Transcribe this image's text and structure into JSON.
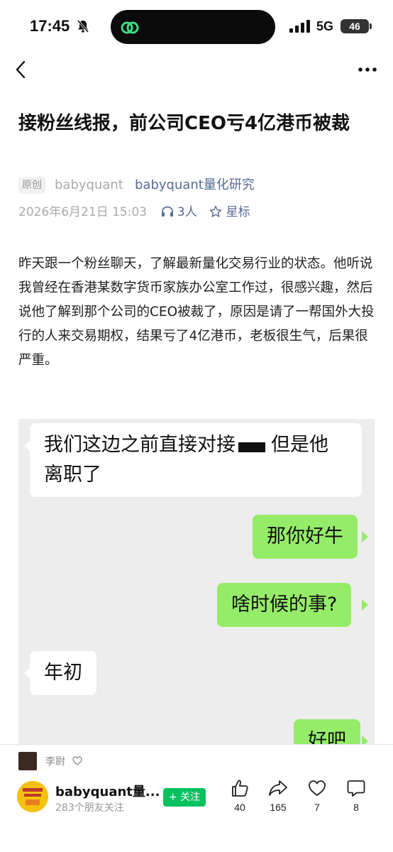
{
  "status_bar": {
    "time": "17:45",
    "network": "5G",
    "battery": "46"
  },
  "article": {
    "title": "接粉丝线报，前公司CEO亏4亿港币被裁",
    "original_tag": "原创",
    "author": "babyquant",
    "account": "babyquant量化研究",
    "date": "2026年6月21日 15:03",
    "listens": "3人",
    "star_label": "星标",
    "body": "昨天跟一个粉丝聊天，了解最新量化交易行业的状态。他听说我曾经在香港某数字货币家族办公室工作过，很感兴趣，然后说他了解到那个公司的CEO被裁了，原因是请了一帮国外大投行的人来交易期权，结果亏了4亿港币，老板很生气，后果很严重。"
  },
  "chat": [
    {
      "side": "left",
      "line1": "我们这边之前直接对接",
      "line1_after": "但是他",
      "line2": "离职了"
    },
    {
      "side": "right",
      "text": "那你好牛"
    },
    {
      "side": "right",
      "text": "啥时候的事?"
    },
    {
      "side": "left",
      "text": "年初"
    },
    {
      "side": "right",
      "text": "好吧"
    }
  ],
  "liker": {
    "name": "李尉"
  },
  "publisher": {
    "name": "babyquant量...",
    "followers": "283个朋友关注",
    "follow_label": "+ 关注"
  },
  "actions": [
    {
      "icon": "thumbs-up-icon",
      "count": "40"
    },
    {
      "icon": "share-icon",
      "count": "165"
    },
    {
      "icon": "heart-icon",
      "count": "7"
    },
    {
      "icon": "comment-icon",
      "count": "8"
    }
  ],
  "colors": {
    "link": "#576b95",
    "bubble_right": "#95ec69",
    "follow": "#07c160"
  }
}
